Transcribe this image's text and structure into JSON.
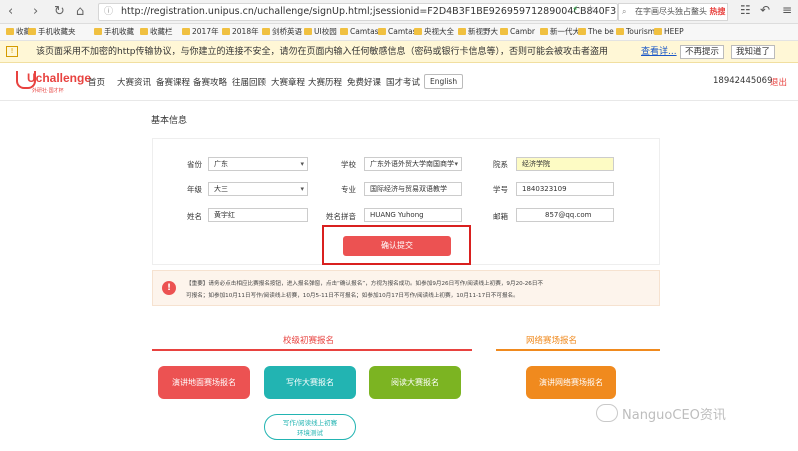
{
  "browser": {
    "url": "http://registration.unipus.cn/uchallenge/signUp.html;jsessionid=F2D4B3F1BE92695971289004CB840F3",
    "search_placeholder": "在字画尽头独占鳌头",
    "search_tag": "热搜",
    "bookmarks": [
      "收藏",
      "手机收藏夹",
      "手机收藏",
      "收藏栏",
      "2017年",
      "2018年",
      "剑桥英语",
      "UI校园",
      "Camtas",
      "Camtas",
      "央视大全",
      "新视野大",
      "Cambr",
      "新一代大",
      "The be",
      "Tourism",
      "HEEP"
    ],
    "warning_text": "该页面采用不加密的http传输协议，与你建立的连接不安全，请勿在页面内输入任何敏感信息（密码或银行卡信息等），否则可能会被攻击者盗用",
    "warning_link": "查看详...",
    "warning_btn1": "不再提示",
    "warning_btn2": "我知道了"
  },
  "header": {
    "logo": "Uchallenge",
    "logo_sub": "外研社·国才杯",
    "nav": [
      "首页",
      "大赛资讯",
      "备赛课程",
      "备赛攻略",
      "往届回顾",
      "大赛章程",
      "大赛历程",
      "免费好课",
      "国才考试"
    ],
    "lang_button": "English",
    "phone": "18942445069",
    "logout": "退出"
  },
  "section_title": "基本信息",
  "form": {
    "province_label": "省份",
    "province_value": "广东",
    "school_label": "学校",
    "school_value": "广东外语外贸大学南国商学",
    "college_label": "院系",
    "college_value": "经济学院",
    "grade_label": "年级",
    "grade_value": "大三",
    "major_label": "专业",
    "major_value": "国际经济与贸易双语教学",
    "student_id_label": "学号",
    "student_id_value": "1840323109",
    "name_label": "姓名",
    "name_value": "黄宇红",
    "pinyin_label": "姓名拼音",
    "pinyin_value": "HUANG Yuhong",
    "email_label": "邮箱",
    "email_value": "857@qq.com",
    "confirm_button": "确认提交"
  },
  "notice": {
    "line1": "【重要】请务必点击相应比赛报名按钮，进入报名弹窗，点击“确认报名”，方视为报名成功。如参加9月26日写作/阅读线上初赛，9月20-26日不",
    "line2": "可报名；如参加10月11日写作/阅读线上初赛，10月5-11日不可报名；如参加10月17日写作/阅读线上初赛，10月11-17日不可报名。"
  },
  "school_section": {
    "title": "校级初赛报名",
    "buttons": [
      "演讲地面赛场报名",
      "写作大赛报名",
      "阅读大赛报名"
    ],
    "test_button_line1": "写作/阅读线上初赛",
    "test_button_line2": "环境测试"
  },
  "online_section": {
    "title": "网络赛场报名",
    "button": "演讲网络赛场报名"
  },
  "watermark": "NanguoCEO资讯",
  "colors": {
    "accent": "#e8423f",
    "red_btn": "#ec5252",
    "teal_btn": "#22b4b2",
    "green_btn": "#7cb422",
    "orange_btn": "#f08a1e",
    "warning_bg": "#fff7d6",
    "notice_bg": "#fdf4ec"
  }
}
